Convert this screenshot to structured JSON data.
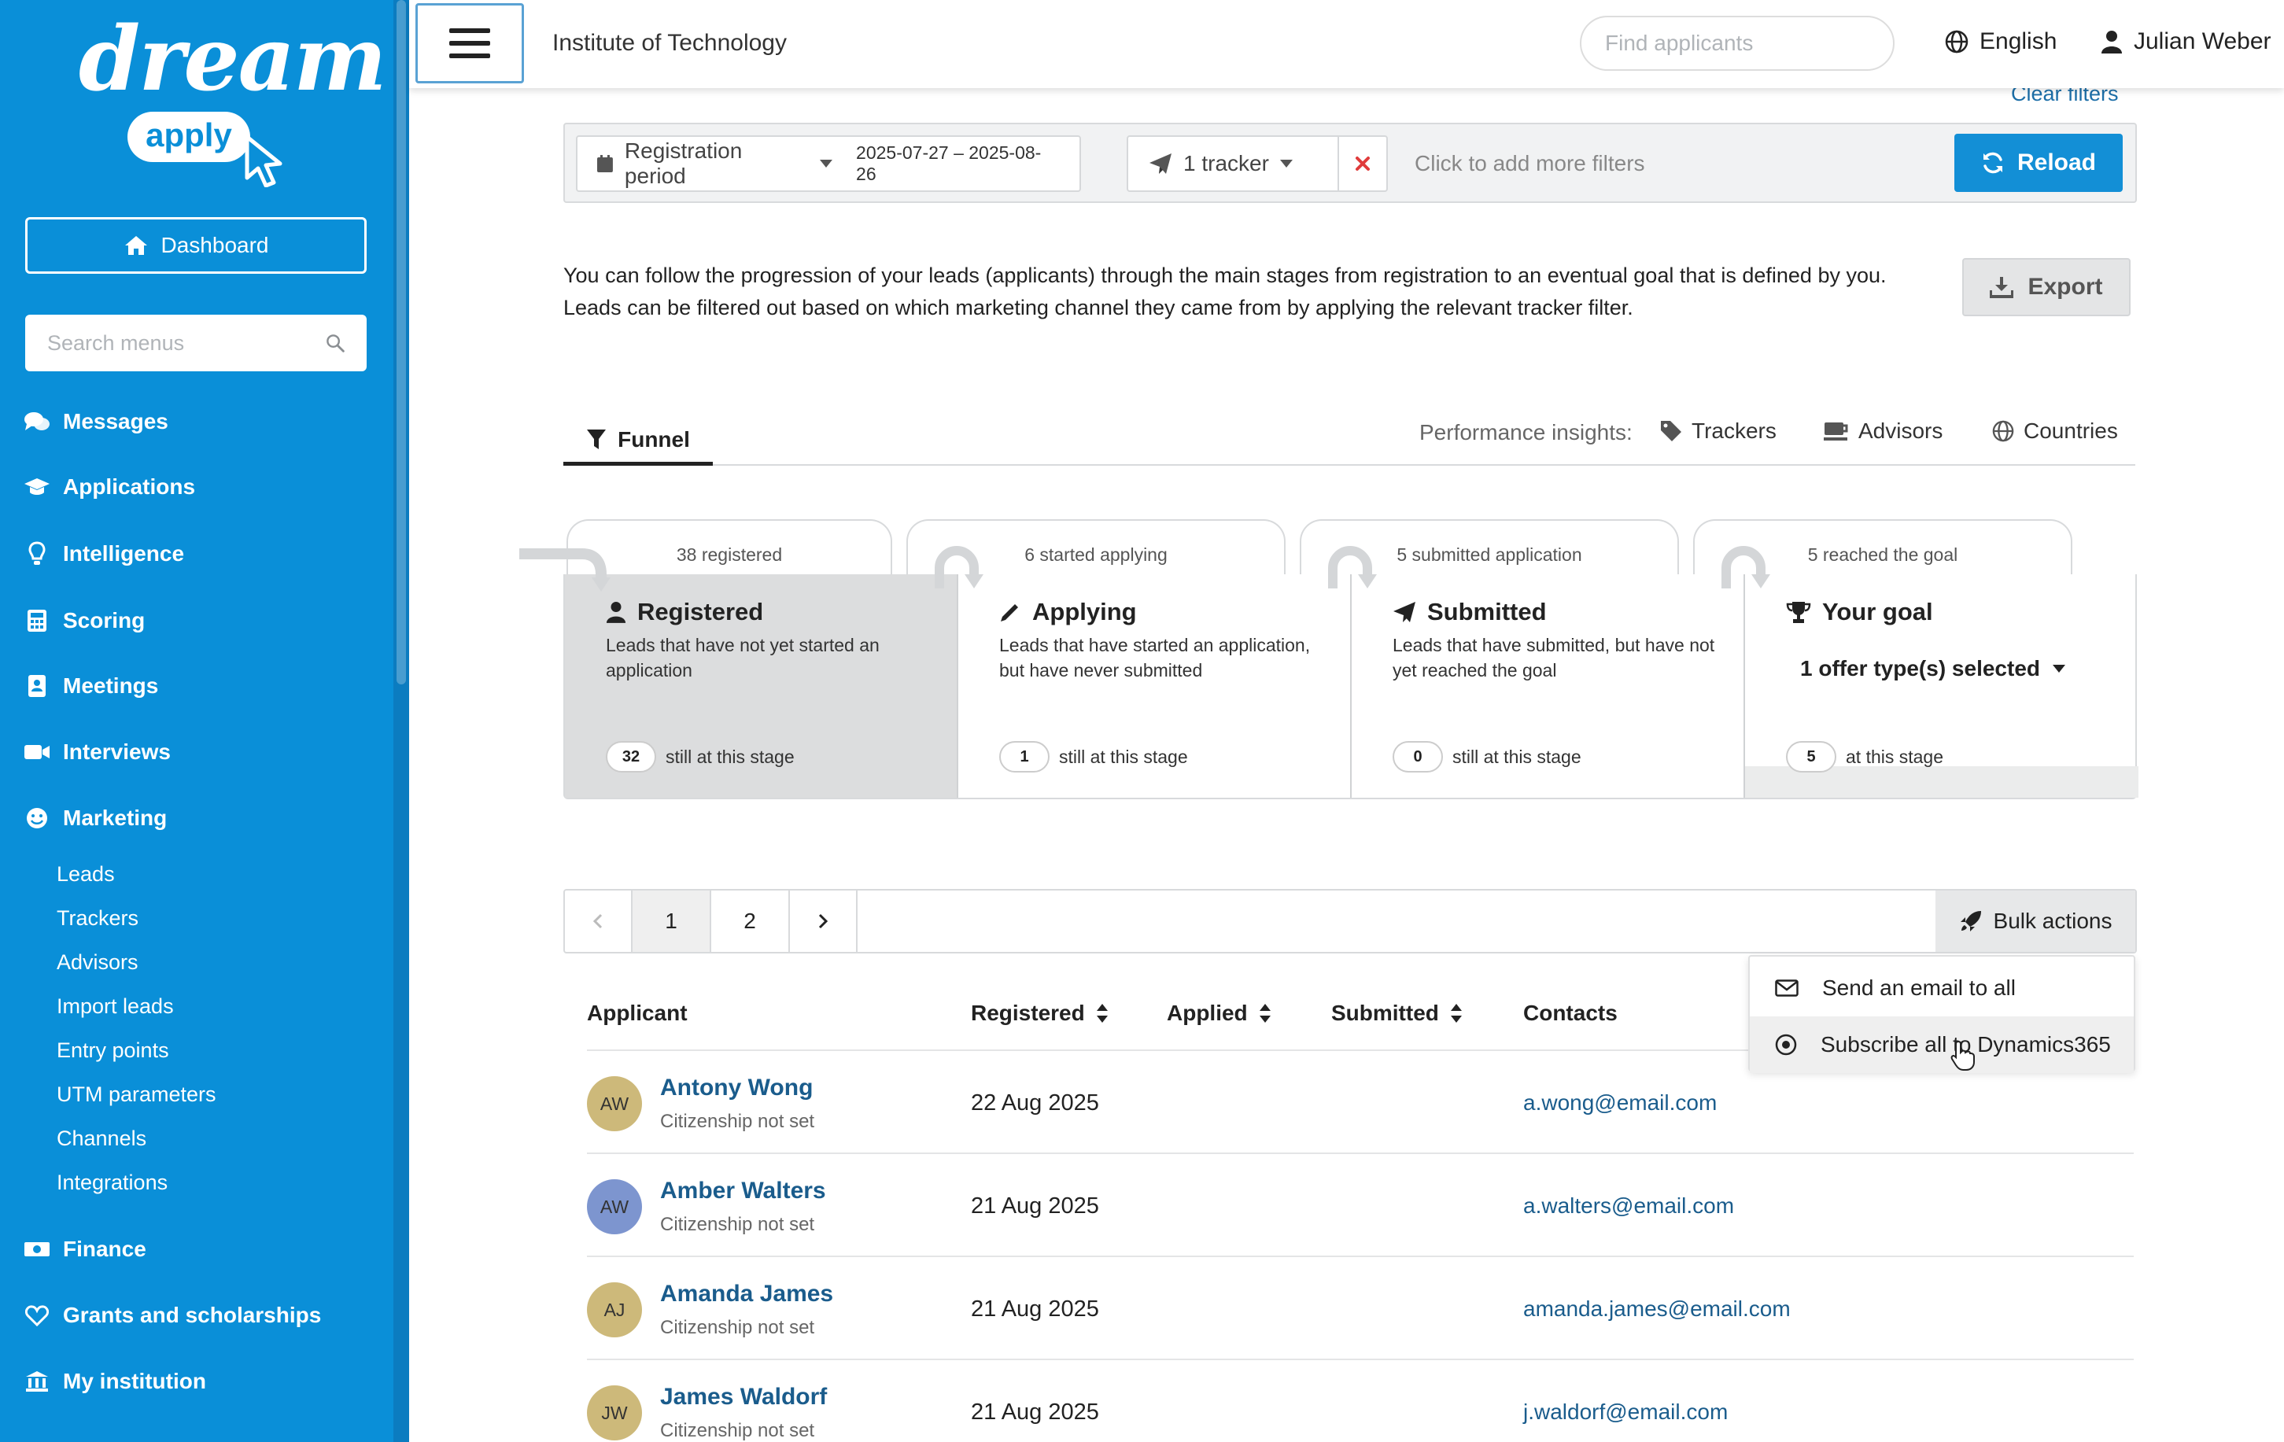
{
  "sidebar": {
    "logo_dream": "dream",
    "logo_apply": "apply",
    "dashboard_label": "Dashboard",
    "search_placeholder": "Search menus",
    "items": [
      {
        "label": "Messages",
        "icon": "comments-icon"
      },
      {
        "label": "Applications",
        "icon": "graduation-cap-icon"
      },
      {
        "label": "Intelligence",
        "icon": "lightbulb-icon"
      },
      {
        "label": "Scoring",
        "icon": "calculator-icon"
      },
      {
        "label": "Meetings",
        "icon": "address-book-icon"
      },
      {
        "label": "Interviews",
        "icon": "video-camera-icon"
      },
      {
        "label": "Marketing",
        "icon": "smile-icon"
      },
      {
        "label": "Finance",
        "icon": "money-icon"
      },
      {
        "label": "Grants and scholarships",
        "icon": "heart-icon"
      },
      {
        "label": "My institution",
        "icon": "bank-icon"
      }
    ],
    "marketing_sub": [
      "Leads",
      "Trackers",
      "Advisors",
      "Import leads",
      "Entry points",
      "UTM parameters",
      "Channels",
      "Integrations"
    ]
  },
  "header": {
    "institution": "Institute of Technology",
    "search_placeholder": "Find applicants",
    "language": "English",
    "user": "Julian Weber"
  },
  "filters": {
    "clear_label": "Clear filters",
    "period_label": "Registration period",
    "period_value": "2025-07-27 – 2025-08-26",
    "tracker_label": "1 tracker",
    "more_placeholder": "Click to add more filters",
    "reload_label": "Reload"
  },
  "intro": {
    "line1": "You can follow the progression of your leads (applicants) through the main stages from registration to an eventual goal that is defined by you.",
    "line2": "Leads can be filtered out based on which marketing channel they came from by applying the relevant tracker filter.",
    "export_label": "Export"
  },
  "tabs": {
    "funnel": "Funnel",
    "insights_label": "Performance insights:",
    "trackers": "Trackers",
    "advisors": "Advisors",
    "countries": "Countries"
  },
  "funnel": {
    "stages": [
      {
        "tab": "38 registered",
        "title": "Registered",
        "desc": "Leads that have not yet started an application",
        "count": "32",
        "count_label": "still at this stage"
      },
      {
        "tab": "6 started applying",
        "title": "Applying",
        "desc": "Leads that have started an application, but have never submitted",
        "count": "1",
        "count_label": "still at this stage"
      },
      {
        "tab": "5 submitted application",
        "title": "Submitted",
        "desc": "Leads that have submitted, but have not yet reached the goal",
        "count": "0",
        "count_label": "still at this stage"
      },
      {
        "tab": "5 reached the goal",
        "title": "Your goal",
        "selector": "1 offer type(s) selected",
        "count": "5",
        "count_label": "at this stage"
      }
    ]
  },
  "pager": {
    "pages": [
      "1",
      "2"
    ],
    "bulk_label": "Bulk actions",
    "bulk_items": [
      "Send an email to all",
      "Subscribe all to Dynamics365"
    ]
  },
  "table": {
    "headers": [
      "Applicant",
      "Registered",
      "Applied",
      "Submitted",
      "Contacts"
    ],
    "rows": [
      {
        "initials": "AW",
        "name": "Antony Wong",
        "citizenship": "Citizenship not set",
        "registered": "22 Aug 2025",
        "email": "a.wong@email.com",
        "color": "#cdb97a"
      },
      {
        "initials": "AW",
        "name": "Amber Walters",
        "citizenship": "Citizenship not set",
        "registered": "21 Aug 2025",
        "email": "a.walters@email.com",
        "color": "#7d95cf"
      },
      {
        "initials": "AJ",
        "name": "Amanda James",
        "citizenship": "Citizenship not set",
        "registered": "21 Aug 2025",
        "email": "amanda.james@email.com",
        "color": "#cdb97a"
      },
      {
        "initials": "JW",
        "name": "James Waldorf",
        "citizenship": "Citizenship not set",
        "registered": "21 Aug 2025",
        "email": "j.waldorf@email.com",
        "color": "#cdb97a"
      }
    ]
  },
  "colors": {
    "sidebar": "#0a8fd8",
    "primary": "#138fd6",
    "link": "#1a5c8c",
    "danger": "#e03c3c"
  }
}
